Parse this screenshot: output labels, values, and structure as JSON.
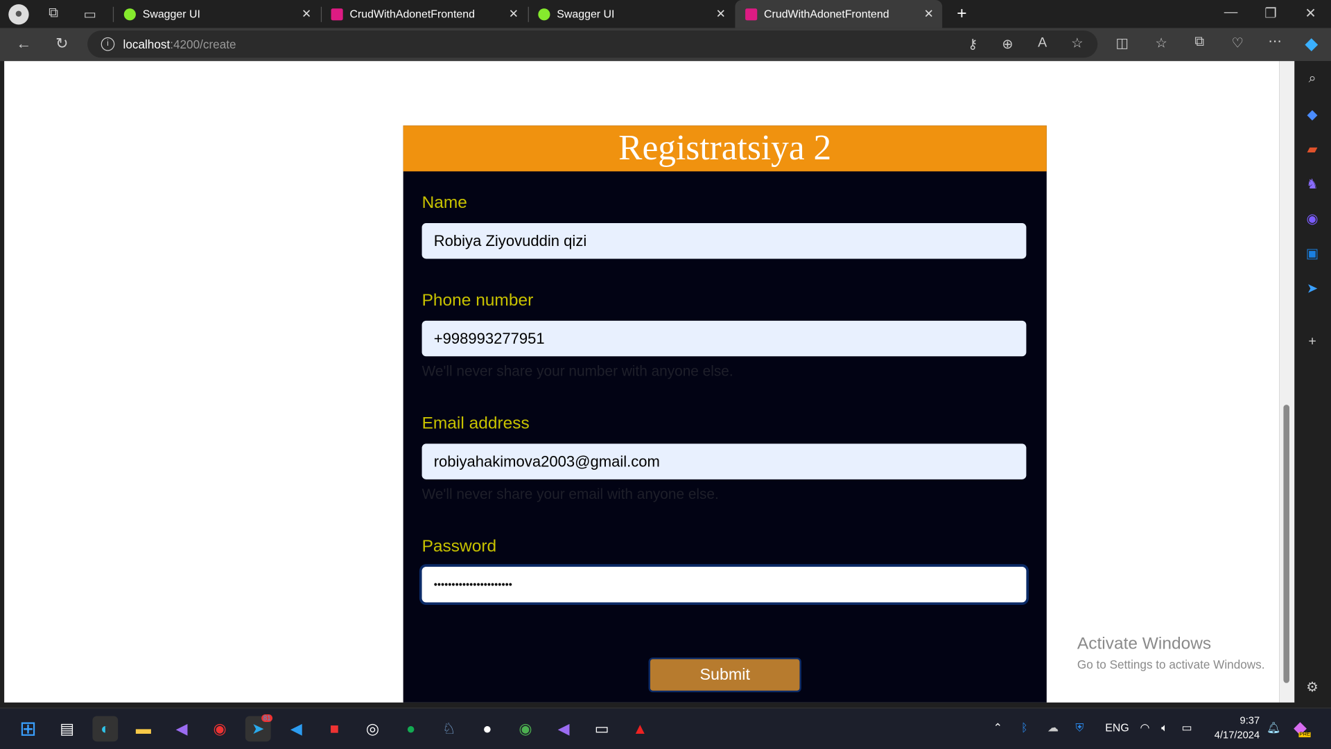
{
  "browser": {
    "tabs": [
      {
        "title": "Swagger UI",
        "icon": "swagger-icon",
        "active": false
      },
      {
        "title": "CrudWithAdonetFrontend",
        "icon": "angular-icon",
        "active": false
      },
      {
        "title": "Swagger UI",
        "icon": "swagger-icon",
        "active": false
      },
      {
        "title": "CrudWithAdonetFrontend",
        "icon": "angular-icon",
        "active": true
      }
    ],
    "address_host": "localhost",
    "address_path": ":4200/create"
  },
  "form": {
    "title": "Registratsiya 2",
    "name_label": "Name",
    "name_value": "Robiya Ziyovuddin qizi",
    "phone_label": "Phone number",
    "phone_value": "+998993277951",
    "phone_hint": "We'll never share your number with anyone else.",
    "email_label": "Email address",
    "email_value": "robiyahakimova2003@gmail.com",
    "email_hint": "We'll never share your email with anyone else.",
    "password_label": "Password",
    "password_value": "••••••••••••••••••••••",
    "submit_label": "Submit"
  },
  "watermark": {
    "title": "Activate Windows",
    "subtitle": "Go to Settings to activate Windows."
  },
  "taskbar": {
    "apps": [
      "windows-start",
      "task-view",
      "edge",
      "file-explorer",
      "visual-studio",
      "screen-recorder",
      "telegram",
      "vscode",
      "app-red",
      "obs",
      "mongodb-compass",
      "postgres",
      "app-circle",
      "chrome",
      "visual-studio-2",
      "terminal",
      "acrobat"
    ],
    "telegram_badge": "81",
    "lang": "ENG",
    "time": "9:37",
    "date": "4/17/2024",
    "copilot_badge": "PRE"
  },
  "colors": {
    "header": "#f0920f",
    "card": "#020314",
    "label": "#c8c200",
    "submit": "#b77b2e"
  }
}
